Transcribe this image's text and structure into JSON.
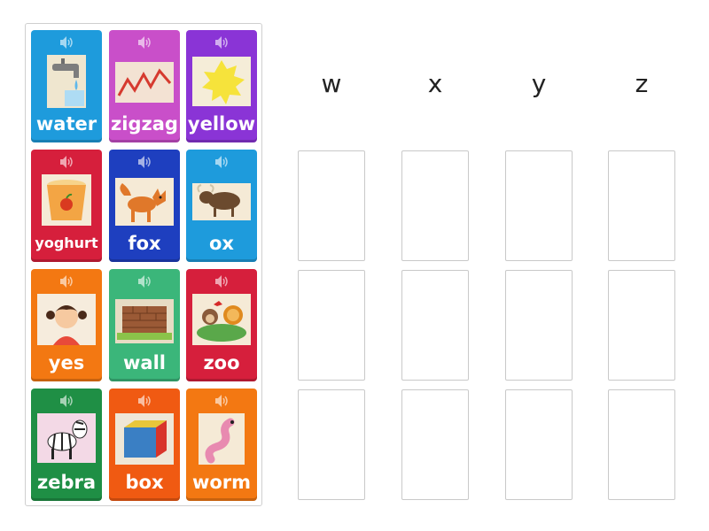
{
  "columns": [
    "w",
    "x",
    "y",
    "z"
  ],
  "cards": [
    {
      "word": "water",
      "color": "#1e9bdc",
      "image": "tap-icon"
    },
    {
      "word": "zigzag",
      "color": "#c94fc9",
      "image": "zigzag-icon"
    },
    {
      "word": "yellow",
      "color": "#8a34d6",
      "image": "yellow-splash-icon"
    },
    {
      "word": "yoghurt",
      "color": "#d61f3c",
      "image": "yoghurt-cup-icon"
    },
    {
      "word": "fox",
      "color": "#1e3fbf",
      "image": "fox-icon"
    },
    {
      "word": "ox",
      "color": "#1e9bdc",
      "image": "ox-icon"
    },
    {
      "word": "yes",
      "color": "#f37812",
      "image": "girl-icon"
    },
    {
      "word": "wall",
      "color": "#3bb67a",
      "image": "brick-wall-icon"
    },
    {
      "word": "zoo",
      "color": "#d61f3c",
      "image": "zoo-animals-icon"
    },
    {
      "word": "zebra",
      "color": "#1f8f45",
      "image": "zebra-icon"
    },
    {
      "word": "box",
      "color": "#f05a12",
      "image": "box-icon"
    },
    {
      "word": "worm",
      "color": "#f37812",
      "image": "worm-icon"
    }
  ]
}
